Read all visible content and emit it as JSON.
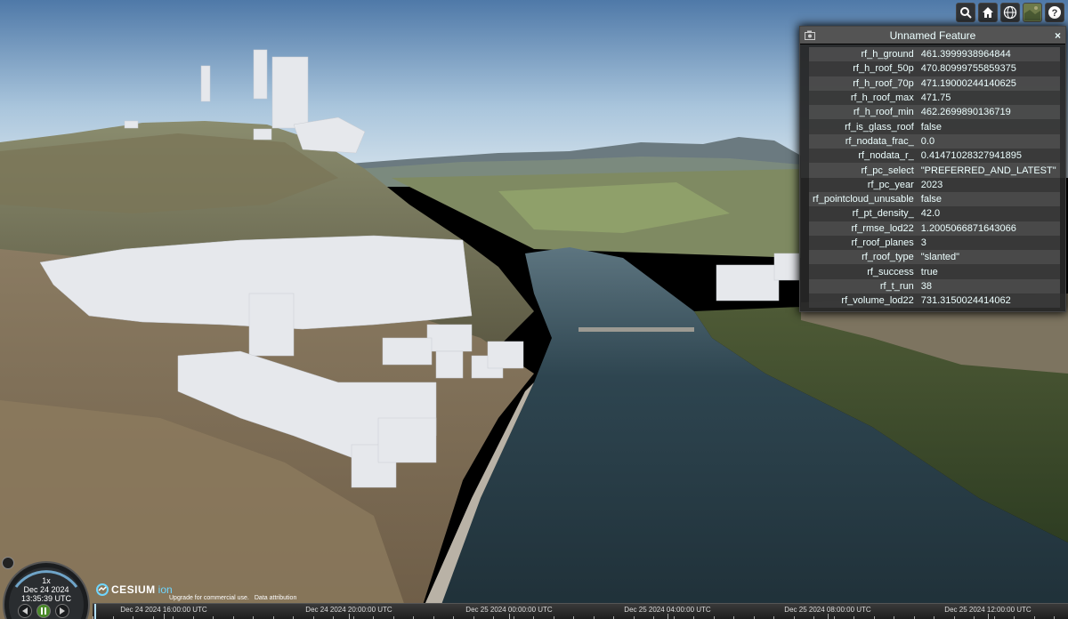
{
  "toolbar": {
    "buttons": [
      {
        "icon": "search-icon"
      },
      {
        "icon": "home-icon"
      },
      {
        "icon": "globe-icon"
      },
      {
        "icon": "imagery-layer-icon"
      },
      {
        "icon": "help-icon"
      }
    ]
  },
  "infobox": {
    "title": "Unnamed Feature",
    "close_label": "×",
    "rows": [
      {
        "key": "rf_h_ground",
        "value": "461.3999938964844"
      },
      {
        "key": "rf_h_roof_50p",
        "value": "470.80999755859375"
      },
      {
        "key": "rf_h_roof_70p",
        "value": "471.19000244140625"
      },
      {
        "key": "rf_h_roof_max",
        "value": "471.75"
      },
      {
        "key": "rf_h_roof_min",
        "value": "462.2699890136719"
      },
      {
        "key": "rf_is_glass_roof",
        "value": "false"
      },
      {
        "key": "rf_nodata_frac_",
        "value": "0.0"
      },
      {
        "key": "rf_nodata_r_",
        "value": "0.41471028327941895"
      },
      {
        "key": "rf_pc_select",
        "value": "\"PREFERRED_AND_LATEST\""
      },
      {
        "key": "rf_pc_year",
        "value": "2023"
      },
      {
        "key": "rf_pointcloud_unusable",
        "value": "false"
      },
      {
        "key": "rf_pt_density_",
        "value": "42.0"
      },
      {
        "key": "rf_rmse_lod22",
        "value": "1.2005066871643066"
      },
      {
        "key": "rf_roof_planes",
        "value": "3"
      },
      {
        "key": "rf_roof_type",
        "value": "\"slanted\""
      },
      {
        "key": "rf_success",
        "value": "true"
      },
      {
        "key": "rf_t_run",
        "value": "38"
      },
      {
        "key": "rf_volume_lod22",
        "value": "731.3150024414062"
      }
    ]
  },
  "animation": {
    "speed": "1x",
    "date": "Dec 24 2024",
    "time": "13:35:39 UTC"
  },
  "credits": {
    "logo_word": "CESIUM",
    "logo_suffix": "ion",
    "upgrade": "Upgrade for commercial use.",
    "attribution": "Data attribution"
  },
  "timeline": {
    "labels": [
      "Dec 24 2024 16:00:00 UTC",
      "Dec 24 2024 20:00:00 UTC",
      "Dec 25 2024 00:00:00 UTC",
      "Dec 25 2024 04:00:00 UTC",
      "Dec 25 2024 08:00:00 UTC",
      "Dec 25 2024 12:00:00 UTC"
    ]
  }
}
